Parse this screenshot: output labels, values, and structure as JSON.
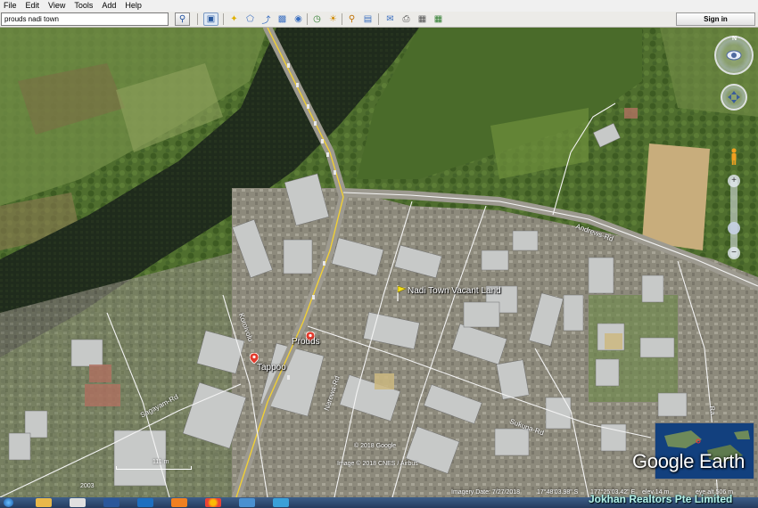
{
  "menu": [
    "File",
    "Edit",
    "View",
    "Tools",
    "Add",
    "Help"
  ],
  "search": {
    "value": "prouds nadi town"
  },
  "toolbar": {
    "signin_label": "Sign in"
  },
  "map": {
    "places": {
      "vacant_land": "Nadi Town Vacant Land",
      "prouds": "Prouds",
      "tappoo": "Tappoo"
    },
    "roads": {
      "andrews": "Andrews-Rd",
      "koroivolu": "Koroivolu",
      "sagayam": "Sagayam-Rd",
      "narewa": "Narewa-Rd",
      "sukuna": "Sukuna-Rd",
      "right_edge": "Ra"
    },
    "copyright": [
      "© 2018 Google",
      "Image © 2018 CNES / Airbus"
    ],
    "scale": "111 m",
    "year": "2003",
    "logo": "Google Earth"
  },
  "nav": {
    "north": "N",
    "zoom_in": "+",
    "zoom_out": "−"
  },
  "status": {
    "imagery_date": "Imagery Date: 7/27/2018",
    "lat": "17°48'03.98\" S",
    "lon": "177°25'03.42\" E",
    "elev": "elev   14 m",
    "eye_alt": "eye alt   506 m"
  },
  "overlay": {
    "realtors": "Jokhan Realtors Pte Limited"
  }
}
